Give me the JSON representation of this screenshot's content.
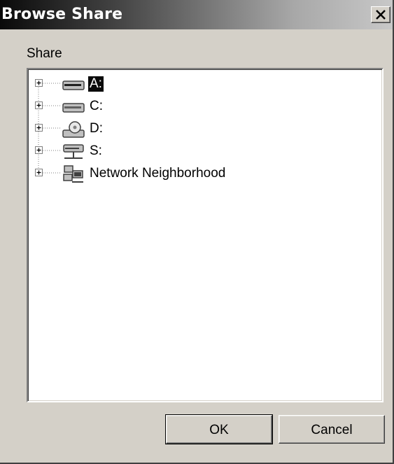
{
  "dialog": {
    "title": "Browse Share",
    "close_icon": "close-icon"
  },
  "share_label": "Share",
  "tree": {
    "items": [
      {
        "label": "A:",
        "icon": "floppy-drive-icon",
        "selected": true
      },
      {
        "label": "C:",
        "icon": "hard-drive-icon",
        "selected": false
      },
      {
        "label": "D:",
        "icon": "cd-drive-icon",
        "selected": false
      },
      {
        "label": "S:",
        "icon": "network-drive-icon",
        "selected": false
      },
      {
        "label": "Network Neighborhood",
        "icon": "network-neighborhood-icon",
        "selected": false
      }
    ]
  },
  "buttons": {
    "ok": "OK",
    "cancel": "Cancel"
  },
  "colors": {
    "window_bg": "#d4d0c8",
    "selection_bg": "#0a0a0a",
    "selection_text": "#ffffff"
  }
}
